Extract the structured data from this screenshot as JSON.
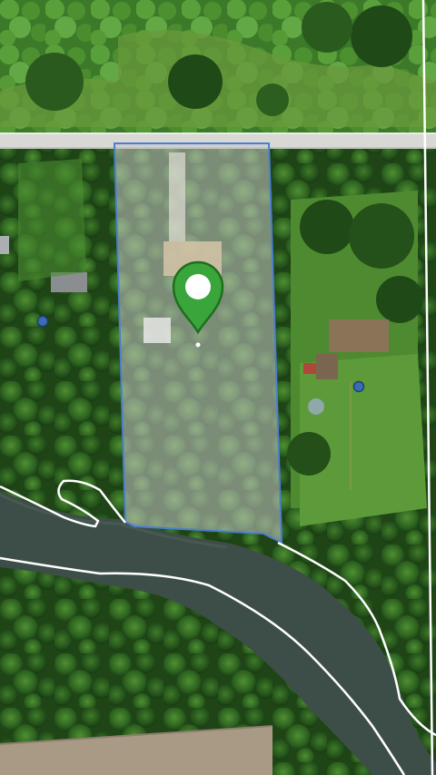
{
  "map": {
    "view": "satellite",
    "colors": {
      "selected_parcel_fill": "#c8c8c8",
      "selected_parcel_border": "#4a7fd0",
      "parcel_lines": "#ffffff",
      "marker_fill": "#3aa53a",
      "marker_stroke": "#1f6e20",
      "poi_dot": "#3a6db5",
      "road": "#d8d8d4",
      "river": "#3d4e48"
    },
    "marker": {
      "icon": "map-pin-icon",
      "state": "selected"
    },
    "poi_dots": [
      {
        "icon": "poi-dot-icon"
      },
      {
        "icon": "poi-dot-icon"
      }
    ]
  }
}
